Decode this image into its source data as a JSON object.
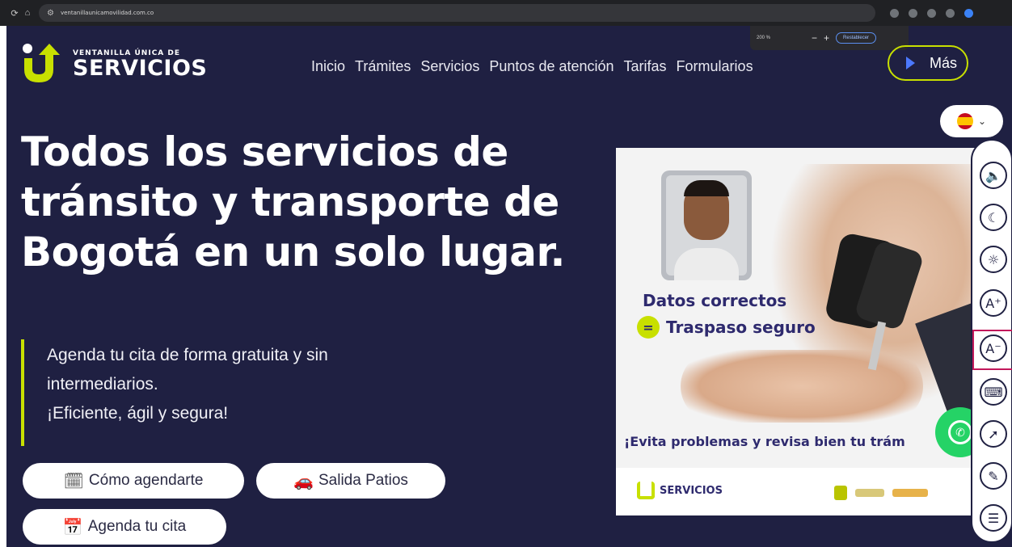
{
  "browser": {
    "url": "ventanillaunicamovilidad.com.co",
    "zoom_level": "200 %",
    "zoom_minus": "−",
    "zoom_plus": "+",
    "zoom_reset": "Restablecer"
  },
  "brand": {
    "small": "VENTANILLA ÚNICA DE",
    "big": "SERVICIOS",
    "accent_color": "#c8e000",
    "bg_color": "#1f2042"
  },
  "nav": {
    "items": [
      "Inicio",
      "Trámites",
      "Servicios",
      "Puntos de atención",
      "Tarifas",
      "Formularios"
    ],
    "more": "Más"
  },
  "headline": {
    "line1": "Todos los servicios de",
    "line2": "tránsito y transporte de",
    "line3": "Bogotá en un solo lugar."
  },
  "intro": {
    "line1": "Agenda tu cita de forma gratuita y sin",
    "line2": "intermediarios.",
    "line3": "¡Eficiente, ágil y segura!"
  },
  "buttons": {
    "como_agendarte": "Cómo agendarte",
    "salida_patios": "Salida Patios",
    "agenda_cita": "Agenda tu cita"
  },
  "promo": {
    "line1": "Datos correctos",
    "line2": "Traspaso seguro",
    "bottom": "¡Evita problemas y revisa bien tu trám",
    "footer_logo": "SERVICIOS"
  },
  "icons": {
    "language_flag": "spain-flag-icon",
    "whatsapp": "whatsapp-icon",
    "tools": [
      "speaker-icon",
      "moon-icon",
      "sun-icon",
      "text-increase-icon",
      "text-decrease-icon",
      "keyboard-icon",
      "cursor-icon",
      "sign-language-icon",
      "line-spacing-icon"
    ]
  }
}
